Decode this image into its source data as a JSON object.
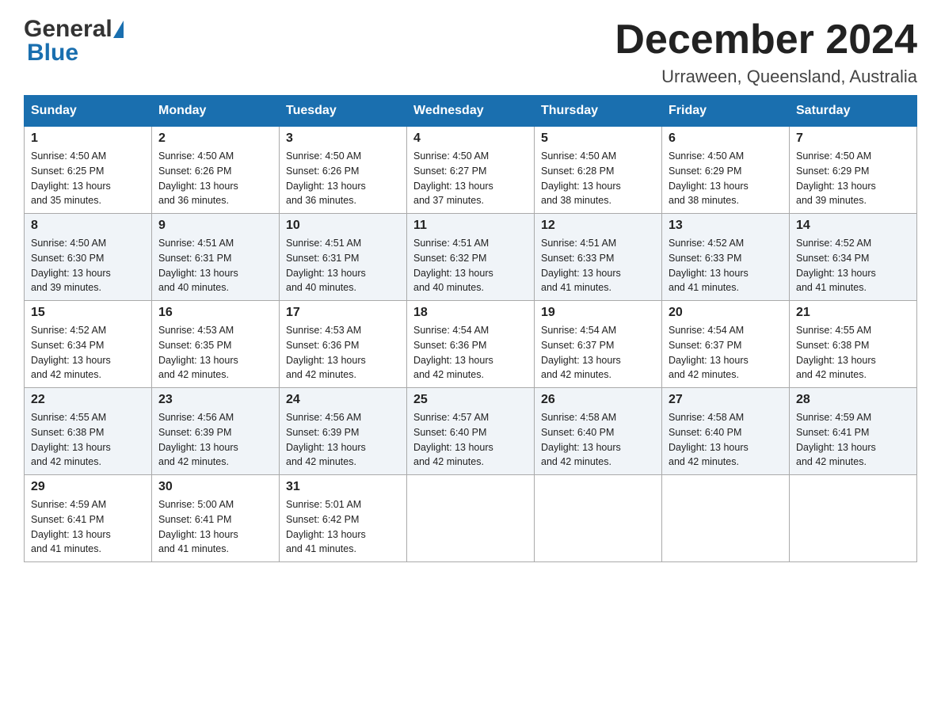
{
  "header": {
    "title": "December 2024",
    "subtitle": "Urraween, Queensland, Australia",
    "logo_general": "General",
    "logo_blue": "Blue"
  },
  "days_of_week": [
    "Sunday",
    "Monday",
    "Tuesday",
    "Wednesday",
    "Thursday",
    "Friday",
    "Saturday"
  ],
  "weeks": [
    [
      {
        "day": "1",
        "sunrise": "4:50 AM",
        "sunset": "6:25 PM",
        "daylight": "13 hours and 35 minutes."
      },
      {
        "day": "2",
        "sunrise": "4:50 AM",
        "sunset": "6:26 PM",
        "daylight": "13 hours and 36 minutes."
      },
      {
        "day": "3",
        "sunrise": "4:50 AM",
        "sunset": "6:26 PM",
        "daylight": "13 hours and 36 minutes."
      },
      {
        "day": "4",
        "sunrise": "4:50 AM",
        "sunset": "6:27 PM",
        "daylight": "13 hours and 37 minutes."
      },
      {
        "day": "5",
        "sunrise": "4:50 AM",
        "sunset": "6:28 PM",
        "daylight": "13 hours and 38 minutes."
      },
      {
        "day": "6",
        "sunrise": "4:50 AM",
        "sunset": "6:29 PM",
        "daylight": "13 hours and 38 minutes."
      },
      {
        "day": "7",
        "sunrise": "4:50 AM",
        "sunset": "6:29 PM",
        "daylight": "13 hours and 39 minutes."
      }
    ],
    [
      {
        "day": "8",
        "sunrise": "4:50 AM",
        "sunset": "6:30 PM",
        "daylight": "13 hours and 39 minutes."
      },
      {
        "day": "9",
        "sunrise": "4:51 AM",
        "sunset": "6:31 PM",
        "daylight": "13 hours and 40 minutes."
      },
      {
        "day": "10",
        "sunrise": "4:51 AM",
        "sunset": "6:31 PM",
        "daylight": "13 hours and 40 minutes."
      },
      {
        "day": "11",
        "sunrise": "4:51 AM",
        "sunset": "6:32 PM",
        "daylight": "13 hours and 40 minutes."
      },
      {
        "day": "12",
        "sunrise": "4:51 AM",
        "sunset": "6:33 PM",
        "daylight": "13 hours and 41 minutes."
      },
      {
        "day": "13",
        "sunrise": "4:52 AM",
        "sunset": "6:33 PM",
        "daylight": "13 hours and 41 minutes."
      },
      {
        "day": "14",
        "sunrise": "4:52 AM",
        "sunset": "6:34 PM",
        "daylight": "13 hours and 41 minutes."
      }
    ],
    [
      {
        "day": "15",
        "sunrise": "4:52 AM",
        "sunset": "6:34 PM",
        "daylight": "13 hours and 42 minutes."
      },
      {
        "day": "16",
        "sunrise": "4:53 AM",
        "sunset": "6:35 PM",
        "daylight": "13 hours and 42 minutes."
      },
      {
        "day": "17",
        "sunrise": "4:53 AM",
        "sunset": "6:36 PM",
        "daylight": "13 hours and 42 minutes."
      },
      {
        "day": "18",
        "sunrise": "4:54 AM",
        "sunset": "6:36 PM",
        "daylight": "13 hours and 42 minutes."
      },
      {
        "day": "19",
        "sunrise": "4:54 AM",
        "sunset": "6:37 PM",
        "daylight": "13 hours and 42 minutes."
      },
      {
        "day": "20",
        "sunrise": "4:54 AM",
        "sunset": "6:37 PM",
        "daylight": "13 hours and 42 minutes."
      },
      {
        "day": "21",
        "sunrise": "4:55 AM",
        "sunset": "6:38 PM",
        "daylight": "13 hours and 42 minutes."
      }
    ],
    [
      {
        "day": "22",
        "sunrise": "4:55 AM",
        "sunset": "6:38 PM",
        "daylight": "13 hours and 42 minutes."
      },
      {
        "day": "23",
        "sunrise": "4:56 AM",
        "sunset": "6:39 PM",
        "daylight": "13 hours and 42 minutes."
      },
      {
        "day": "24",
        "sunrise": "4:56 AM",
        "sunset": "6:39 PM",
        "daylight": "13 hours and 42 minutes."
      },
      {
        "day": "25",
        "sunrise": "4:57 AM",
        "sunset": "6:40 PM",
        "daylight": "13 hours and 42 minutes."
      },
      {
        "day": "26",
        "sunrise": "4:58 AM",
        "sunset": "6:40 PM",
        "daylight": "13 hours and 42 minutes."
      },
      {
        "day": "27",
        "sunrise": "4:58 AM",
        "sunset": "6:40 PM",
        "daylight": "13 hours and 42 minutes."
      },
      {
        "day": "28",
        "sunrise": "4:59 AM",
        "sunset": "6:41 PM",
        "daylight": "13 hours and 42 minutes."
      }
    ],
    [
      {
        "day": "29",
        "sunrise": "4:59 AM",
        "sunset": "6:41 PM",
        "daylight": "13 hours and 41 minutes."
      },
      {
        "day": "30",
        "sunrise": "5:00 AM",
        "sunset": "6:41 PM",
        "daylight": "13 hours and 41 minutes."
      },
      {
        "day": "31",
        "sunrise": "5:01 AM",
        "sunset": "6:42 PM",
        "daylight": "13 hours and 41 minutes."
      },
      null,
      null,
      null,
      null
    ]
  ],
  "labels": {
    "sunrise": "Sunrise:",
    "sunset": "Sunset:",
    "daylight": "Daylight:"
  }
}
